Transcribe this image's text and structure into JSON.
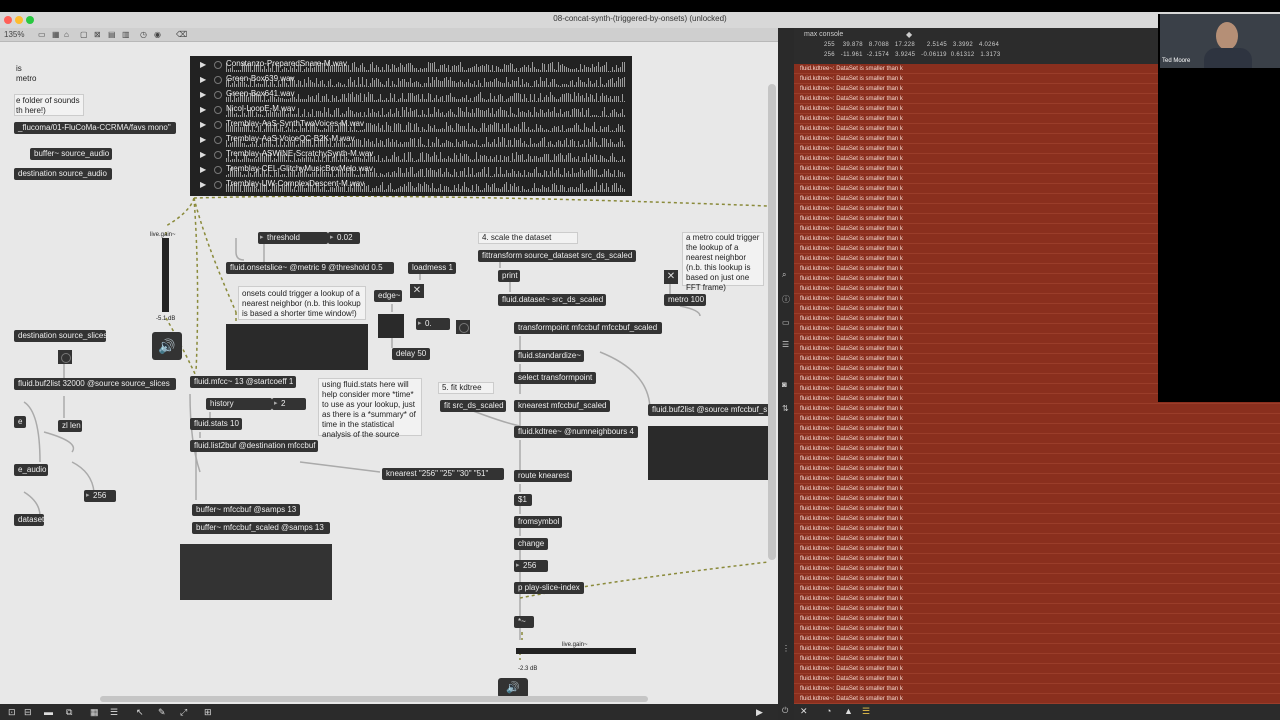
{
  "window": {
    "title": "08-concat-synth-(triggered-by-onsets) (unlocked)",
    "zoom": "135%"
  },
  "colors": {
    "console_bg": "#8a2f1e",
    "patcher_bg": "#e8e8e8",
    "object_bg": "#333333"
  },
  "sound_files": [
    "Constanzo-PreparedSnare-M.wav",
    "Green-Box639.wav",
    "Green-Box641.wav",
    "Nicol-LoopE-M.wav",
    "Tremblay-AaS-SynthTwoVoices-M.wav",
    "Tremblay-AaS-VoiceQC-B2K-M.wav",
    "Tremblay-ASWINE-ScratchySynth-M.wav",
    "Tremblay-CEL-GlitchyMusicBoxMelo.wav",
    "Tremblay-UW-ComplexDescent-M.wav"
  ],
  "left_edge": {
    "c1": "is\nmetro",
    "c2": "e folder of sounds\nth here!)",
    "path": "_flucoma/01-FluCoMa-CCRMA/favs mono\"",
    "buffer_src": "buffer~ source_audio",
    "dest_src": "destination source_audio",
    "dest_slices": "destination source_slices",
    "buf2list": "fluid.buf2list 32000 @source source_slices",
    "e_frag": "e",
    "zl": "zl len",
    "e_audio": "e_audio",
    "num256": "256",
    "dataset": "dataset"
  },
  "gain_left": {
    "label": "live.gain~",
    "db": "-5.1 dB"
  },
  "center": {
    "threshold_msg": "threshold",
    "threshold_val": "0.02",
    "onsetslice": "fluid.onsetslice~ @metric 9 @threshold 0.5",
    "loadmess": "loadmess 1",
    "onsets_comment": "onsets could trigger a lookup of a\nnearest neighbor (n.b. this lookup\nis based a shorter time window!)",
    "edge": "edge~",
    "num0": "0.",
    "delay": "delay 50",
    "mfcc": "fluid.mfcc~ 13 @startcoeff 1",
    "history": "history",
    "num2": "2",
    "stats": "fluid.stats 10",
    "list2buf": "fluid.list2buf @destination mfccbuf",
    "stats_comment": "using fluid.stats here will\nhelp consider more *time*\nto use as your lookup, just\nas there is a *summary* of\ntime in the statistical\nanalysis of the source",
    "buffer_mfcc": "buffer~ mfccbuf @samps 13",
    "buffer_mfcc_scaled": "buffer~ mfccbuf_scaled @samps 13"
  },
  "right_chain": {
    "scale_comment": "4. scale the dataset",
    "fittransform": "fittransform source_dataset src_ds_scaled",
    "print": "print",
    "dataset_scaled": "fluid.dataset~ src_ds_scaled",
    "metro_comment": "a metro could trigger\nthe lookup of a\nnearest neighbor\n(n.b. this lookup is\nbased on just one\nFFT frame)",
    "metro": "metro 100",
    "transformpoint": "transformpoint mfccbuf mfccbuf_scaled",
    "standardize": "fluid.standardize~",
    "select_tp": "select transformpoint",
    "fit_comment": "5. fit kdtree",
    "fit": "fit src_ds_scaled",
    "knearest": "knearest mfccbuf_scaled",
    "kdtree": "fluid.kdtree~ @numneighbours 4",
    "buf2list_src": "fluid.buf2list @source mfccbuf_s",
    "knearest_msg": "knearest \"256\" \"25\" \"30\" \"51\"",
    "route": "route knearest",
    "dollar1": "$1",
    "fromsymbol": "fromsymbol",
    "change": "change",
    "num256": "256",
    "play": "p play-slice-index",
    "tilde": "*~",
    "gain_label": "live.gain~",
    "gain_db": "-2.3 dB"
  },
  "console": {
    "title": "max console",
    "row1": "255    39.878   8.7088   17.228      2.5145   3.3992   4.0264",
    "row2": "256   -11.961  -2.1574   3.9245   -0.06119  0.61312   1.3173",
    "message": "fluid.kdtree~: DataSet is smaller than k",
    "message_count": 64
  },
  "webcam": {
    "name": "Ted Moore"
  }
}
